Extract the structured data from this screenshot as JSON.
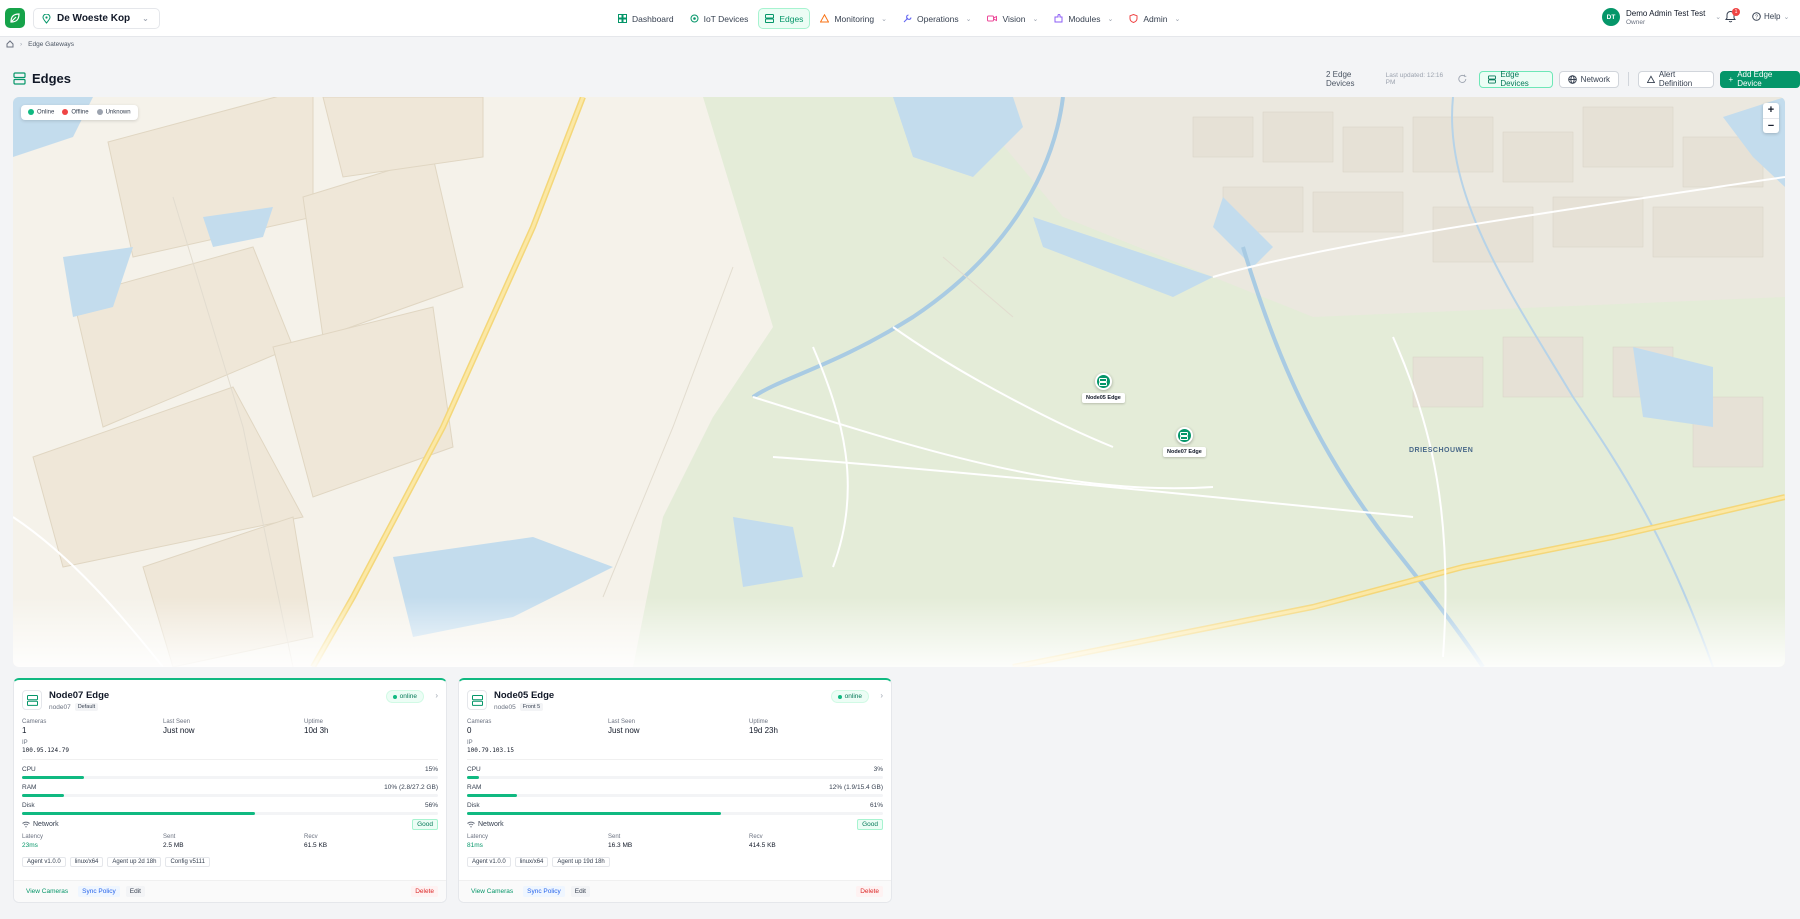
{
  "topbar": {
    "site": "De Woeste Kop",
    "nav": [
      {
        "label": "Dashboard",
        "icon": "dashboard-icon",
        "color": "#059669"
      },
      {
        "label": "IoT Devices",
        "icon": "chip-icon",
        "color": "#059669"
      },
      {
        "label": "Edges",
        "icon": "server-icon",
        "color": "#059669",
        "active": true
      },
      {
        "label": "Monitoring",
        "icon": "warning-icon",
        "color": "#f97316",
        "dropdown": true
      },
      {
        "label": "Operations",
        "icon": "wrench-icon",
        "color": "#6366f1",
        "dropdown": true
      },
      {
        "label": "Vision",
        "icon": "camera-icon",
        "color": "#ec4899",
        "dropdown": true
      },
      {
        "label": "Modules",
        "icon": "puzzle-icon",
        "color": "#8b5cf6",
        "dropdown": true
      },
      {
        "label": "Admin",
        "icon": "shield-icon",
        "color": "#ef4444",
        "dropdown": true
      }
    ],
    "user": {
      "initials": "DT",
      "name": "Demo Admin Test Test",
      "role": "Owner"
    },
    "notifications": "1",
    "help": "Help"
  },
  "breadcrumb": {
    "current": "Edge Gateways"
  },
  "page": {
    "title": "Edges",
    "count": "2 Edge Devices",
    "updated": "Last updated: 12:16 PM",
    "tabs": {
      "devices": "Edge Devices",
      "network": "Network"
    },
    "alert_button": "Alert Definition",
    "add_button": "Add Edge Device"
  },
  "map": {
    "legend": {
      "online": "Online",
      "offline": "Offline",
      "unknown": "Unknown"
    },
    "legend_colors": {
      "online": "#10b981",
      "offline": "#ef4444",
      "unknown": "#9ca3af"
    },
    "zoom_in": "+",
    "zoom_out": "−",
    "area_label": "DRIESCHOUWEN",
    "markers": [
      {
        "label": "Node05 Edge"
      },
      {
        "label": "Node07 Edge"
      }
    ]
  },
  "cards": [
    {
      "name": "Node07 Edge",
      "id": "node07",
      "tag": "Default",
      "status": "online",
      "cameras_label": "Cameras",
      "cameras": "1",
      "last_seen_label": "Last Seen",
      "last_seen": "Just now",
      "uptime_label": "Uptime",
      "uptime": "10d 3h",
      "ip_label": "IP",
      "ip": "100.95.124.79",
      "cpu_label": "CPU",
      "cpu": "15%",
      "cpu_pct": 15,
      "ram_label": "RAM",
      "ram": "10% (2.8/27.2 GB)",
      "ram_pct": 10,
      "disk_label": "Disk",
      "disk": "56%",
      "disk_pct": 56,
      "network_label": "Network",
      "network_status": "Good",
      "latency_label": "Latency",
      "latency": "23ms",
      "sent_label": "Sent",
      "sent": "2.5 MB",
      "recv_label": "Recv",
      "recv": "61.5 KB",
      "chips": [
        "Agent v1.0.0",
        "linux/x64",
        "Agent up 2d 18h",
        "Config v5111"
      ],
      "actions": {
        "cameras": "View Cameras",
        "sync": "Sync Policy",
        "edit": "Edit",
        "delete": "Delete"
      }
    },
    {
      "name": "Node05 Edge",
      "id": "node05",
      "tag": "Front 5",
      "status": "online",
      "cameras_label": "Cameras",
      "cameras": "0",
      "last_seen_label": "Last Seen",
      "last_seen": "Just now",
      "uptime_label": "Uptime",
      "uptime": "19d 23h",
      "ip_label": "IP",
      "ip": "100.79.103.15",
      "cpu_label": "CPU",
      "cpu": "3%",
      "cpu_pct": 3,
      "ram_label": "RAM",
      "ram": "12% (1.9/15.4 GB)",
      "ram_pct": 12,
      "disk_label": "Disk",
      "disk": "61%",
      "disk_pct": 61,
      "network_label": "Network",
      "network_status": "Good",
      "latency_label": "Latency",
      "latency": "81ms",
      "sent_label": "Sent",
      "sent": "16.3 MB",
      "recv_label": "Recv",
      "recv": "414.5 KB",
      "chips": [
        "Agent v1.0.0",
        "linux/x64",
        "Agent up 19d 18h"
      ],
      "actions": {
        "cameras": "View Cameras",
        "sync": "Sync Policy",
        "edit": "Edit",
        "delete": "Delete"
      }
    }
  ]
}
